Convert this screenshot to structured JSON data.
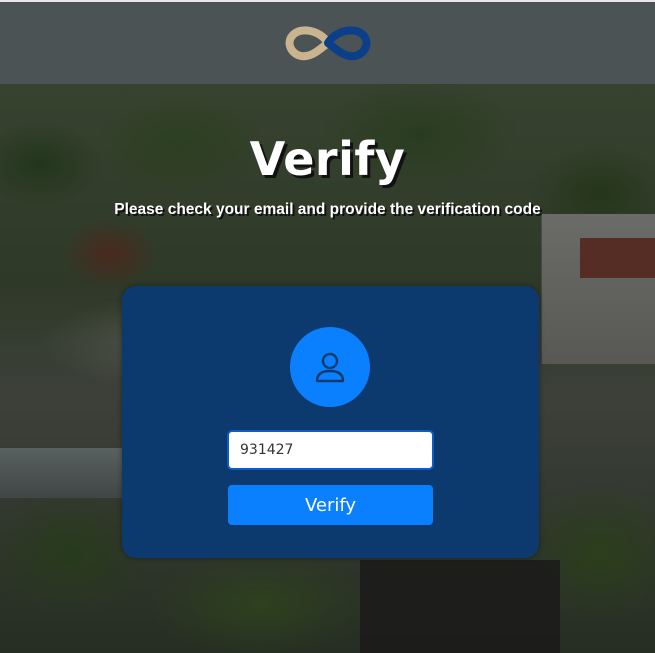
{
  "header": {
    "logo_icon": "infinity-loop-logo-icon",
    "logo_colors": {
      "left": "#c9b48f",
      "right": "#0b3f8a"
    },
    "background_color": "#4b5355"
  },
  "main": {
    "title": "Verify",
    "subtitle": "Please check your email and provide the verification code"
  },
  "card": {
    "background_color": "#0d3a6e",
    "avatar_icon": "user-icon",
    "code_input": {
      "value": "931427",
      "placeholder": ""
    },
    "verify_button_label": "Verify",
    "accent_color": "#0b80ff"
  }
}
